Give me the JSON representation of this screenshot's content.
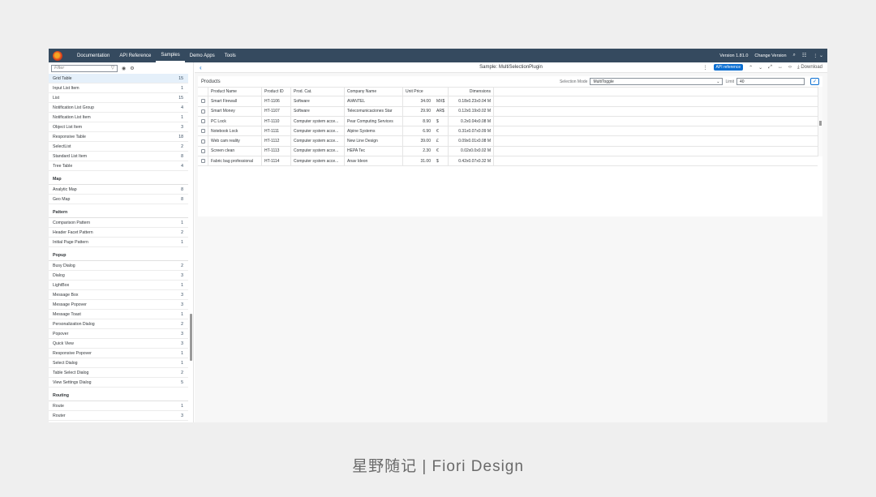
{
  "shell": {
    "nav": [
      "Documentation",
      "API Reference",
      "Samples",
      "Demo Apps",
      "Tools"
    ],
    "active_nav": "Samples",
    "version": "Version 1.81.0",
    "change_version": "Change Version"
  },
  "sidebar": {
    "filter_placeholder": "Filter",
    "entries": [
      {
        "label": "Grid Table",
        "count": "15",
        "selected": true
      },
      {
        "label": "Input List Item",
        "count": "1"
      },
      {
        "label": "List",
        "count": "15"
      },
      {
        "label": "Notification List Group",
        "count": "4"
      },
      {
        "label": "Notification List Item",
        "count": "1"
      },
      {
        "label": "Object List Item",
        "count": "3"
      },
      {
        "label": "Responsive Table",
        "count": "18"
      },
      {
        "label": "SelectList",
        "count": "2"
      },
      {
        "label": "Standard List Item",
        "count": "8"
      },
      {
        "label": "Tree Table",
        "count": "4"
      },
      {
        "group": "Map"
      },
      {
        "label": "Analytic Map",
        "count": "8"
      },
      {
        "label": "Geo Map",
        "count": "8"
      },
      {
        "group": "Pattern"
      },
      {
        "label": "Comparison Pattern",
        "count": "1"
      },
      {
        "label": "Header Facet Pattern",
        "count": "2"
      },
      {
        "label": "Initial Page Pattern",
        "count": "1"
      },
      {
        "group": "Popup"
      },
      {
        "label": "Busy Dialog",
        "count": "2"
      },
      {
        "label": "Dialog",
        "count": "3"
      },
      {
        "label": "LightBox",
        "count": "1"
      },
      {
        "label": "Message Box",
        "count": "3"
      },
      {
        "label": "Message Popover",
        "count": "3"
      },
      {
        "label": "Message Toast",
        "count": "1"
      },
      {
        "label": "Personalization Dialog",
        "count": "2"
      },
      {
        "label": "Popover",
        "count": "3"
      },
      {
        "label": "Quick View",
        "count": "3"
      },
      {
        "label": "Responsive Popover",
        "count": "1"
      },
      {
        "label": "Select Dialog",
        "count": "1"
      },
      {
        "label": "Table Select Dialog",
        "count": "2"
      },
      {
        "label": "View Settings Dialog",
        "count": "5"
      },
      {
        "group": "Routing"
      },
      {
        "label": "Route",
        "count": "1"
      },
      {
        "label": "Router",
        "count": "3"
      }
    ]
  },
  "toolbar": {
    "title": "Sample: MultiSelectionPlugin",
    "api_reference": "API reference",
    "download": "Download"
  },
  "panel": {
    "title": "Products",
    "selection_mode_label": "Selection Mode",
    "selection_mode_value": "MultiToggle",
    "limit_label": "Limit",
    "limit_value": "40"
  },
  "table": {
    "columns": [
      "Product Name",
      "Product ID",
      "Prod. Cat.",
      "Company Name",
      "Unit Price",
      "Dimensions"
    ],
    "rows": [
      {
        "name": "Smart Firewall",
        "id": "HT-1106",
        "cat": "Software",
        "company": "AVANTEL",
        "price": "34.00",
        "currency": "MX$",
        "dim": "0.18x0.23x0.04 M"
      },
      {
        "name": "Smart Money",
        "id": "HT-1107",
        "cat": "Software",
        "company": "Telecomunicaciones Star",
        "price": "29.90",
        "currency": "AR$",
        "dim": "0.12x0.19x0.02 M"
      },
      {
        "name": "PC Lock",
        "id": "HT-1110",
        "cat": "Computer system acce...",
        "company": "Pear Computing Services",
        "price": "8.90",
        "currency": "$",
        "dim": "0.2x0.04x0.08 M"
      },
      {
        "name": "Notebook Lock",
        "id": "HT-1111",
        "cat": "Computer system acce...",
        "company": "Alpine Systems",
        "price": "6.90",
        "currency": "€",
        "dim": "0.31x0.07x0.09 M"
      },
      {
        "name": "Web cam reality",
        "id": "HT-1112",
        "cat": "Computer system acce...",
        "company": "New Line Design",
        "price": "39.00",
        "currency": "£",
        "dim": "0.09x0.01x0.08 M"
      },
      {
        "name": "Screen clean",
        "id": "HT-1113",
        "cat": "Computer system acce...",
        "company": "HEPA Tec",
        "price": "2.30",
        "currency": "€",
        "dim": "0.02x0.0x0.02 M"
      },
      {
        "name": "Fabric bag professional",
        "id": "HT-1114",
        "cat": "Computer system acce...",
        "company": "Anav Ideon",
        "price": "31.00",
        "currency": "$",
        "dim": "0.42x0.07x0.32 M"
      }
    ]
  },
  "footer": {
    "caption": "星野随记 | Fiori Design"
  },
  "icons": {
    "filter": "funnel-icon",
    "search": "search-icon",
    "settings": "gear-icon"
  },
  "colors": {
    "shell": "#354a5f",
    "accent": "#0a6ed1",
    "selected_row": "#e5f0fa"
  }
}
